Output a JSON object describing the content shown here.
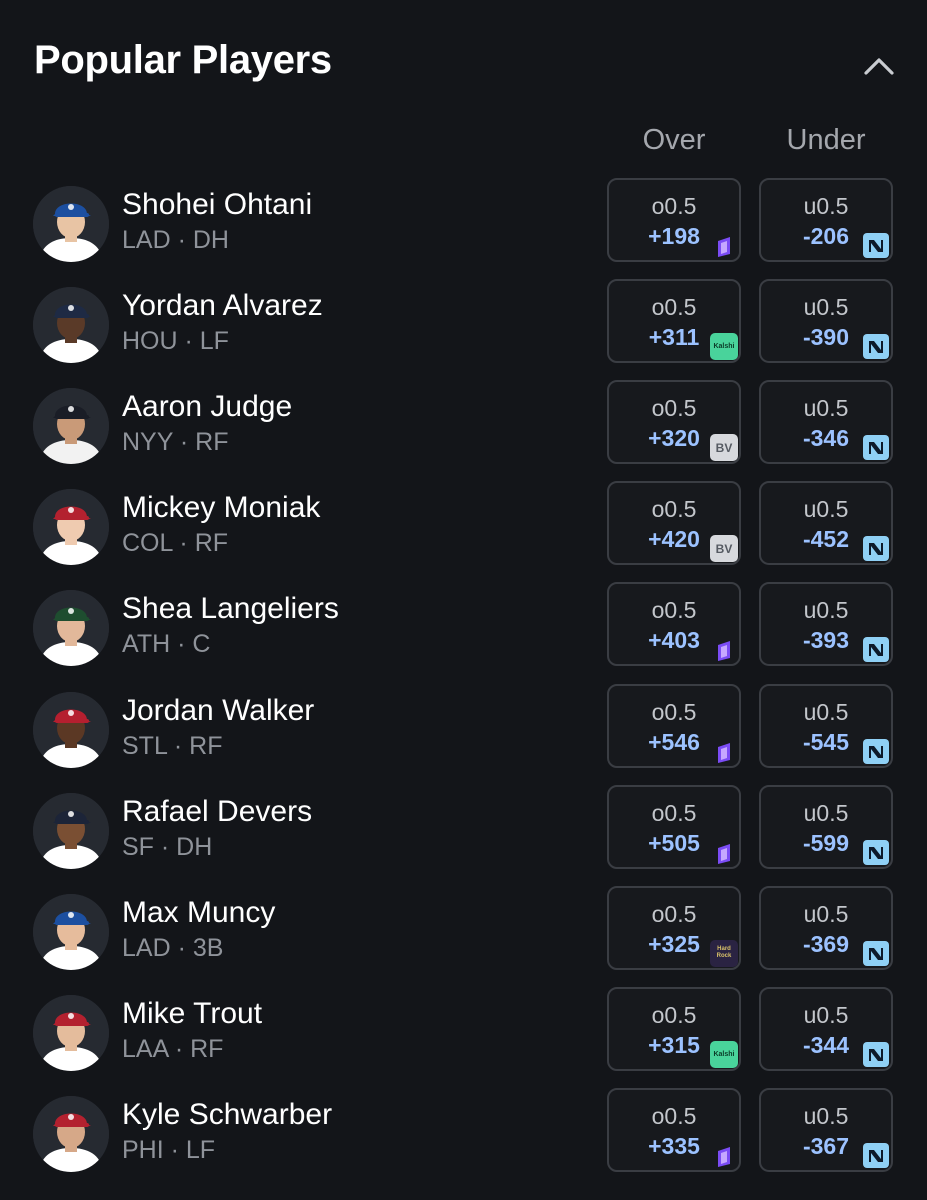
{
  "header": {
    "title": "Popular Players",
    "collapse_icon": "chevron-up-icon"
  },
  "columns": {
    "over": "Over",
    "under": "Under"
  },
  "colors": {
    "background": "#131519",
    "odds_text": "#9cc2ff",
    "cell_border": "#3a3d43"
  },
  "players": [
    {
      "name": "Shohei Ohtani",
      "meta": "LAD · DH",
      "cap_color": "#1c4fa0",
      "jersey": "#ffffff",
      "skin": "#e8c4a4",
      "over": {
        "line": "o0.5",
        "odds": "+198",
        "book": "polymarket",
        "book_label": ""
      },
      "under": {
        "line": "u0.5",
        "odds": "-206",
        "book": "novig",
        "book_label": ""
      }
    },
    {
      "name": "Yordan Alvarez",
      "meta": "HOU · LF",
      "cap_color": "#1e2a44",
      "jersey": "#ffffff",
      "skin": "#5a3a28",
      "over": {
        "line": "o0.5",
        "odds": "+311",
        "book": "kalshi",
        "book_label": "Kalshi"
      },
      "under": {
        "line": "u0.5",
        "odds": "-390",
        "book": "novig",
        "book_label": ""
      }
    },
    {
      "name": "Aaron Judge",
      "meta": "NYY · RF",
      "cap_color": "#1a1d26",
      "jersey": "#f2f2f2",
      "skin": "#c99a78",
      "over": {
        "line": "o0.5",
        "odds": "+320",
        "book": "bv",
        "book_label": "BV"
      },
      "under": {
        "line": "u0.5",
        "odds": "-346",
        "book": "novig",
        "book_label": ""
      }
    },
    {
      "name": "Mickey Moniak",
      "meta": "COL · RF",
      "cap_color": "#b3212f",
      "jersey": "#ffffff",
      "skin": "#efcbb0",
      "over": {
        "line": "o0.5",
        "odds": "+420",
        "book": "bv",
        "book_label": "BV"
      },
      "under": {
        "line": "u0.5",
        "odds": "-452",
        "book": "novig",
        "book_label": ""
      }
    },
    {
      "name": "Shea Langeliers",
      "meta": "ATH · C",
      "cap_color": "#1e4d2f",
      "jersey": "#ffffff",
      "skin": "#e2b89a",
      "over": {
        "line": "o0.5",
        "odds": "+403",
        "book": "polymarket",
        "book_label": ""
      },
      "under": {
        "line": "u0.5",
        "odds": "-393",
        "book": "novig",
        "book_label": ""
      }
    },
    {
      "name": "Jordan Walker",
      "meta": "STL · RF",
      "cap_color": "#b51f2f",
      "jersey": "#ffffff",
      "skin": "#5b3824",
      "over": {
        "line": "o0.5",
        "odds": "+546",
        "book": "polymarket",
        "book_label": ""
      },
      "under": {
        "line": "u0.5",
        "odds": "-545",
        "book": "novig",
        "book_label": ""
      }
    },
    {
      "name": "Rafael Devers",
      "meta": "SF · DH",
      "cap_color": "#1c2438",
      "jersey": "#ffffff",
      "skin": "#7a4f33",
      "over": {
        "line": "o0.5",
        "odds": "+505",
        "book": "polymarket",
        "book_label": ""
      },
      "under": {
        "line": "u0.5",
        "odds": "-599",
        "book": "novig",
        "book_label": ""
      }
    },
    {
      "name": "Max Muncy",
      "meta": "LAD · 3B",
      "cap_color": "#1c4fa0",
      "jersey": "#ffffff",
      "skin": "#e6bc9c",
      "over": {
        "line": "o0.5",
        "odds": "+325",
        "book": "hardrock",
        "book_label": "Hard Rock"
      },
      "under": {
        "line": "u0.5",
        "odds": "-369",
        "book": "novig",
        "book_label": ""
      }
    },
    {
      "name": "Mike Trout",
      "meta": "LAA · RF",
      "cap_color": "#b3212f",
      "jersey": "#ffffff",
      "skin": "#e4bc9c",
      "over": {
        "line": "o0.5",
        "odds": "+315",
        "book": "kalshi",
        "book_label": "Kalshi"
      },
      "under": {
        "line": "u0.5",
        "odds": "-344",
        "book": "novig",
        "book_label": ""
      }
    },
    {
      "name": "Kyle Schwarber",
      "meta": "PHI · LF",
      "cap_color": "#b3212f",
      "jersey": "#ffffff",
      "skin": "#d6a888",
      "over": {
        "line": "o0.5",
        "odds": "+335",
        "book": "polymarket",
        "book_label": ""
      },
      "under": {
        "line": "u0.5",
        "odds": "-367",
        "book": "novig",
        "book_label": ""
      }
    }
  ]
}
